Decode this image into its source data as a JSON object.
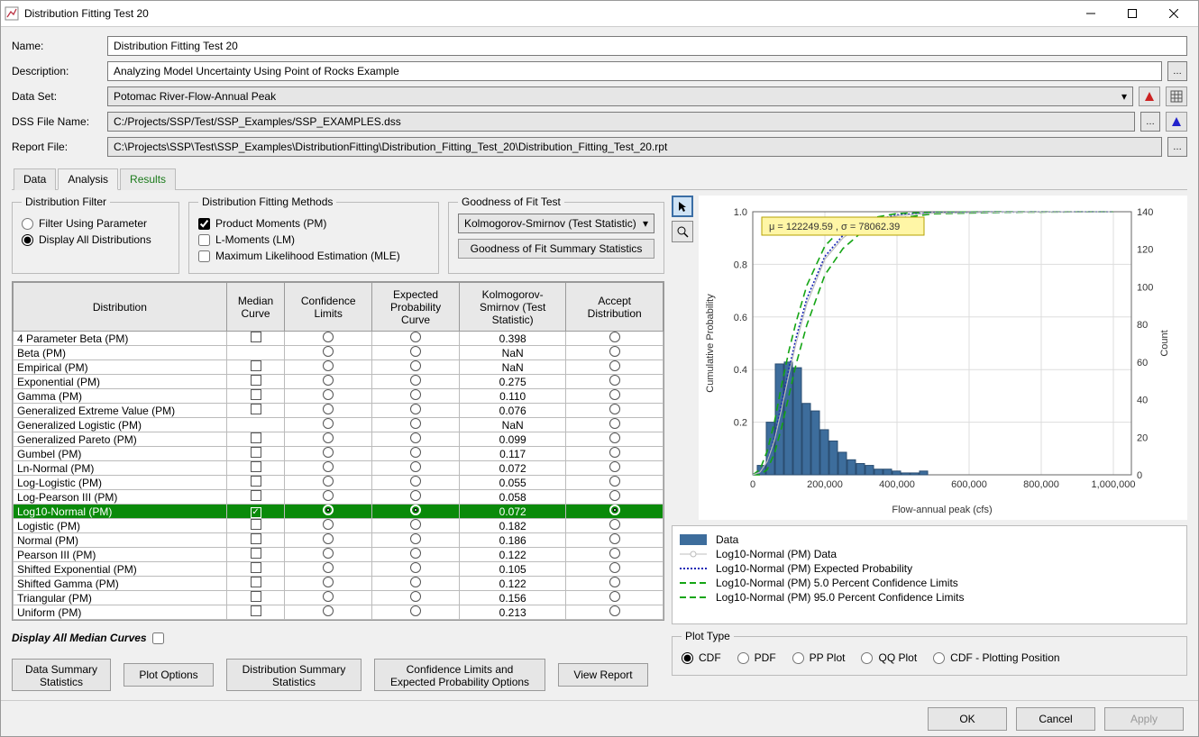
{
  "window": {
    "title": "Distribution Fitting Test 20"
  },
  "form": {
    "name_label": "Name:",
    "name_value": "Distribution Fitting Test 20",
    "desc_label": "Description:",
    "desc_value": "Analyzing Model Uncertainty Using Point of Rocks Example",
    "dataset_label": "Data Set:",
    "dataset_value": "Potomac River-Flow-Annual Peak",
    "dss_label": "DSS File Name:",
    "dss_value": "C:/Projects/SSP/Test/SSP_Examples/SSP_EXAMPLES.dss",
    "report_label": "Report File:",
    "report_value": "C:\\Projects\\SSP\\Test\\SSP_Examples\\DistributionFitting\\Distribution_Fitting_Test_20\\Distribution_Fitting_Test_20.rpt"
  },
  "tabs": {
    "data": "Data",
    "analysis": "Analysis",
    "results": "Results"
  },
  "filter": {
    "legend": "Distribution Filter",
    "opt_param": "Filter Using Parameter",
    "opt_all": "Display All Distributions"
  },
  "methods": {
    "legend": "Distribution Fitting Methods",
    "pm": "Product Moments (PM)",
    "lm": "L-Moments (LM)",
    "mle": "Maximum Likelihood Estimation (MLE)"
  },
  "gof": {
    "legend": "Goodness of Fit Test",
    "select": "Kolmogorov-Smirnov (Test Statistic)",
    "summary_btn": "Goodness of Fit Summary Statistics"
  },
  "table": {
    "headers": {
      "dist": "Distribution",
      "median": "Median Curve",
      "conf": "Confidence Limits",
      "exp": "Expected Probability Curve",
      "ks": "Kolmogorov-Smirnov (Test Statistic)",
      "accept": "Accept Distribution"
    },
    "rows": [
      {
        "name": "4 Parameter Beta (PM)",
        "ks": "0.398",
        "sel": false
      },
      {
        "name": "Beta (PM)",
        "ks": "NaN",
        "sel": false,
        "nomedian": true
      },
      {
        "name": "Empirical (PM)",
        "ks": "NaN",
        "sel": false
      },
      {
        "name": "Exponential (PM)",
        "ks": "0.275",
        "sel": false
      },
      {
        "name": "Gamma (PM)",
        "ks": "0.110",
        "sel": false
      },
      {
        "name": "Generalized Extreme Value (PM)",
        "ks": "0.076",
        "sel": false
      },
      {
        "name": "Generalized Logistic (PM)",
        "ks": "NaN",
        "sel": false,
        "nomedian": true
      },
      {
        "name": "Generalized Pareto (PM)",
        "ks": "0.099",
        "sel": false
      },
      {
        "name": "Gumbel (PM)",
        "ks": "0.117",
        "sel": false
      },
      {
        "name": "Ln-Normal (PM)",
        "ks": "0.072",
        "sel": false
      },
      {
        "name": "Log-Logistic (PM)",
        "ks": "0.055",
        "sel": false
      },
      {
        "name": "Log-Pearson III (PM)",
        "ks": "0.058",
        "sel": false
      },
      {
        "name": "Log10-Normal (PM)",
        "ks": "0.072",
        "sel": true
      },
      {
        "name": "Logistic (PM)",
        "ks": "0.182",
        "sel": false
      },
      {
        "name": "Normal (PM)",
        "ks": "0.186",
        "sel": false
      },
      {
        "name": "Pearson III (PM)",
        "ks": "0.122",
        "sel": false
      },
      {
        "name": "Shifted Exponential (PM)",
        "ks": "0.105",
        "sel": false
      },
      {
        "name": "Shifted Gamma (PM)",
        "ks": "0.122",
        "sel": false
      },
      {
        "name": "Triangular (PM)",
        "ks": "0.156",
        "sel": false
      },
      {
        "name": "Uniform (PM)",
        "ks": "0.213",
        "sel": false
      }
    ]
  },
  "display_all_median": "Display All Median Curves",
  "bottom": {
    "data_summary": "Data Summary Statistics",
    "plot_options": "Plot Options",
    "dist_summary": "Distribution Summary Statistics",
    "conf_options": "Confidence Limits and Expected Probability Options",
    "view_report": "View Report"
  },
  "chart": {
    "annotation": "μ = 122249.59 , σ = 78062.39",
    "xlabel": "Flow-annual peak (cfs)",
    "ylabel_left": "Cumulative Probability",
    "ylabel_right": "Count",
    "legend_items": [
      {
        "label": "Data",
        "type": "bar",
        "color": "#3d6d9c"
      },
      {
        "label": "Log10-Normal (PM) Data",
        "type": "circles",
        "color": "#bcbcbc"
      },
      {
        "label": "Log10-Normal (PM) Expected Probability",
        "type": "dotted",
        "color": "#1523b5"
      },
      {
        "label": "Log10-Normal (PM) 5.0 Percent Confidence Limits",
        "type": "dashed",
        "color": "#14a514"
      },
      {
        "label": "Log10-Normal (PM) 95.0 Percent Confidence Limits",
        "type": "dashed",
        "color": "#14a514"
      }
    ]
  },
  "chart_data": {
    "type": "bar",
    "title": "",
    "xlabel": "Flow-annual peak (cfs)",
    "ylabel": "Cumulative Probability",
    "ylabel2": "Count",
    "xlim": [
      0,
      1050000
    ],
    "ylim_left": [
      0,
      1.0
    ],
    "ylim_right": [
      0,
      140
    ],
    "annotation": "μ = 122249.59 , σ = 78062.39",
    "xticks": [
      0,
      200000,
      400000,
      600000,
      800000,
      1000000
    ],
    "yticks_left": [
      0.2,
      0.4,
      0.6,
      0.8,
      1.0
    ],
    "yticks_right": [
      0,
      20,
      40,
      60,
      80,
      100,
      120,
      140
    ],
    "hist_bin_centers": [
      25000,
      50000,
      75000,
      100000,
      125000,
      150000,
      175000,
      200000,
      225000,
      250000,
      275000,
      300000,
      325000,
      350000,
      375000,
      400000,
      425000,
      450000,
      475000
    ],
    "hist_counts": [
      5,
      28,
      59,
      60,
      57,
      38,
      34,
      24,
      18,
      12,
      8,
      6,
      5,
      3,
      3,
      2,
      1,
      1,
      2
    ],
    "cdf_x": [
      0,
      20000,
      40000,
      60000,
      80000,
      100000,
      120000,
      150000,
      200000,
      250000,
      300000,
      400000,
      500000,
      700000,
      1000000
    ],
    "cdf_median": [
      0.0,
      0.01,
      0.05,
      0.13,
      0.25,
      0.38,
      0.5,
      0.65,
      0.82,
      0.9,
      0.95,
      0.985,
      0.995,
      0.999,
      1.0
    ],
    "cdf_expected": [
      0.0,
      0.01,
      0.05,
      0.14,
      0.27,
      0.4,
      0.52,
      0.67,
      0.83,
      0.91,
      0.955,
      0.988,
      0.996,
      0.999,
      1.0
    ],
    "cdf_lo_5pct": [
      0.0,
      0.0,
      0.02,
      0.08,
      0.18,
      0.3,
      0.42,
      0.57,
      0.76,
      0.86,
      0.92,
      0.975,
      0.992,
      0.998,
      1.0
    ],
    "cdf_hi_95pct": [
      0.0,
      0.02,
      0.09,
      0.2,
      0.34,
      0.47,
      0.58,
      0.72,
      0.87,
      0.94,
      0.97,
      0.993,
      0.998,
      1.0,
      1.0
    ]
  },
  "plot_type": {
    "legend": "Plot Type",
    "options": [
      "CDF",
      "PDF",
      "PP Plot",
      "QQ Plot",
      "CDF - Plotting Position"
    ],
    "selected": "CDF"
  },
  "footer": {
    "ok": "OK",
    "cancel": "Cancel",
    "apply": "Apply"
  }
}
